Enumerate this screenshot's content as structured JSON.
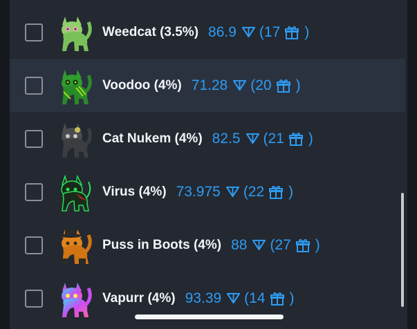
{
  "items": [
    {
      "name": "Weedcat (3.5%)",
      "value": "86.9",
      "prefix": "(17",
      "suffix": ")",
      "avatar": "weedcat-avatar",
      "color": "#8fd06a",
      "accent": "#c5f09a"
    },
    {
      "name": "Voodoo (4%)",
      "value": "71.28",
      "prefix": "(20",
      "suffix": ")",
      "avatar": "voodoo-avatar",
      "color": "#2f9c2e",
      "accent": "#9be01f"
    },
    {
      "name": "Cat Nukem (4%)",
      "value": "82.5",
      "prefix": "(21",
      "suffix": ")",
      "avatar": "cat-nukem-avatar",
      "color": "#4a4c50",
      "accent": "#c8c25a"
    },
    {
      "name": "Virus (4%)",
      "value": "73.975",
      "prefix": "(22",
      "suffix": ")",
      "avatar": "virus-avatar",
      "color": "#1a2a1a",
      "accent": "#29e05a"
    },
    {
      "name": "Puss in Boots (4%)",
      "value": "88",
      "prefix": "(27",
      "suffix": ")",
      "avatar": "puss-in-boots-avatar",
      "color": "#e2841c",
      "accent": "#2a2a2a"
    },
    {
      "name": "Vapurr (4%)",
      "value": "93.39",
      "prefix": "(14",
      "suffix": ")",
      "avatar": "vapurr-avatar",
      "color": "#c94ff0",
      "accent": "#35d7ff"
    }
  ],
  "icons": {
    "currency": "triangle-currency-icon",
    "gift": "gift-icon",
    "checkbox": "checkbox-unchecked"
  },
  "colors": {
    "price": "#2e9cf2",
    "name": "#f2f4f7",
    "background": "#232831",
    "highlight": "#2a3240"
  }
}
